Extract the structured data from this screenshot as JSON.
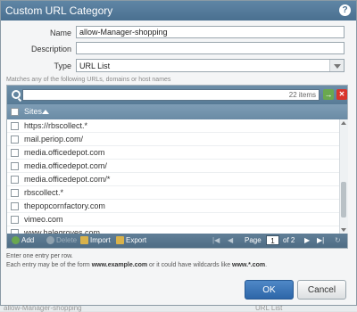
{
  "dialog": {
    "title": "Custom URL Category",
    "help_icon": "help-icon"
  },
  "form": {
    "name_label": "Name",
    "name_value": "allow-Manager-shopping",
    "description_label": "Description",
    "description_value": "",
    "type_label": "Type",
    "type_value": "URL List"
  },
  "hint": "Matches any of the following URLs, domains or host names",
  "list": {
    "search_value": "",
    "item_count": "22 items",
    "column_header": "Sites",
    "rows": [
      "https://rbscollect.*",
      "mail.periop.com/",
      "media.officedepot.com",
      "media.officedepot.com/",
      "media.officedepot.com/*",
      "rbscollect.*",
      "thepopcornfactory.com",
      "vimeo.com",
      "www.halegroves.com"
    ]
  },
  "toolbar": {
    "add": "Add",
    "delete": "Delete",
    "import": "Import",
    "export": "Export",
    "page_label": "Page",
    "page_value": "1",
    "page_total": "of 2"
  },
  "footnote": {
    "line1": "Enter one entry per row.",
    "line2_prefix": "Each entry may be of the form",
    "line2_example1": "www.example.com",
    "line2_mid": "or it could have wildcards like",
    "line2_example2": "www.*.com",
    "line2_end": "."
  },
  "buttons": {
    "ok": "OK",
    "cancel": "Cancel"
  },
  "background": {
    "left_text": "allow-Manager-shopping",
    "right_text": "URL List"
  },
  "colors": {
    "titlebar": "#4a7090",
    "ok_button": "#2d66a8",
    "add_icon": "#6aa84f",
    "clear_icon": "#d9342b"
  }
}
